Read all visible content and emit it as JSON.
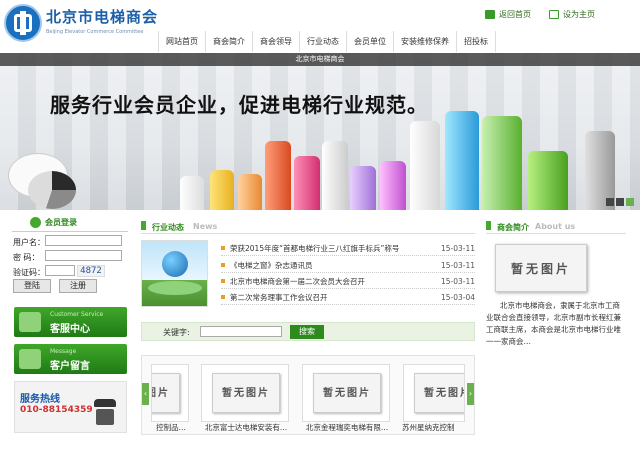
{
  "header": {
    "logo_title": "北京市电梯商会",
    "logo_subtitle": "Beijing Elevator Commerce Committee",
    "home_link": "返回首页",
    "set_home_link": "设为主页"
  },
  "nav": {
    "items": [
      "网站首页",
      "商会简介",
      "商会领导",
      "行业动态",
      "会员单位",
      "安装维修保养",
      "招投标"
    ]
  },
  "banner": {
    "caption": "北京市电梯商会",
    "slogan": "服务行业会员企业，促进电梯行业规范。"
  },
  "login": {
    "title": "会员登录",
    "username_label": "用户名：",
    "password_label": "密  码：",
    "captcha_label": "验证码：",
    "captcha_code": "4872",
    "login_button": "登陆",
    "register_button": "注册"
  },
  "service": {
    "customer_en": "Customer Service",
    "customer_cn": "客服中心",
    "message_en": "Message",
    "message_cn": "客户留言",
    "hotline_title": "服务热线",
    "hotline_number": "010-88154359"
  },
  "news": {
    "title": "行业动态",
    "title_en": "News",
    "items": [
      {
        "title": "荣获2015年度“首都电梯行业三八红旗手标兵”称号",
        "date": "15-03-11"
      },
      {
        "title": "《电梯之窗》杂志通讯员",
        "date": "15-03-11"
      },
      {
        "title": "北京市电梯商会第一届二次会员大会召开",
        "date": "15-03-11"
      },
      {
        "title": "第二次常务理事工作会议召开",
        "date": "15-03-04"
      }
    ]
  },
  "search": {
    "keyword_label": "关键字:",
    "button": "搜索"
  },
  "about": {
    "title": "商会简介",
    "title_en": "About us",
    "no_image": "暂无图片",
    "text": "北京市电梯商会，隶属于北京市工商业联合会直接领导，北京市副市长程红兼工商联主席，本商会是北京市电梯行业唯一一家商会…"
  },
  "products": {
    "no_image": "暂无图片",
    "captions": [
      "控制品...",
      "北京富士达电梯安装有...",
      "北京金程瑞奕电梯有限...",
      "苏州星纳克控制"
    ]
  },
  "colors": {
    "brand_blue": "#1b5fa8",
    "accent_green": "#3fa72a",
    "hotline_red": "#d03030"
  }
}
